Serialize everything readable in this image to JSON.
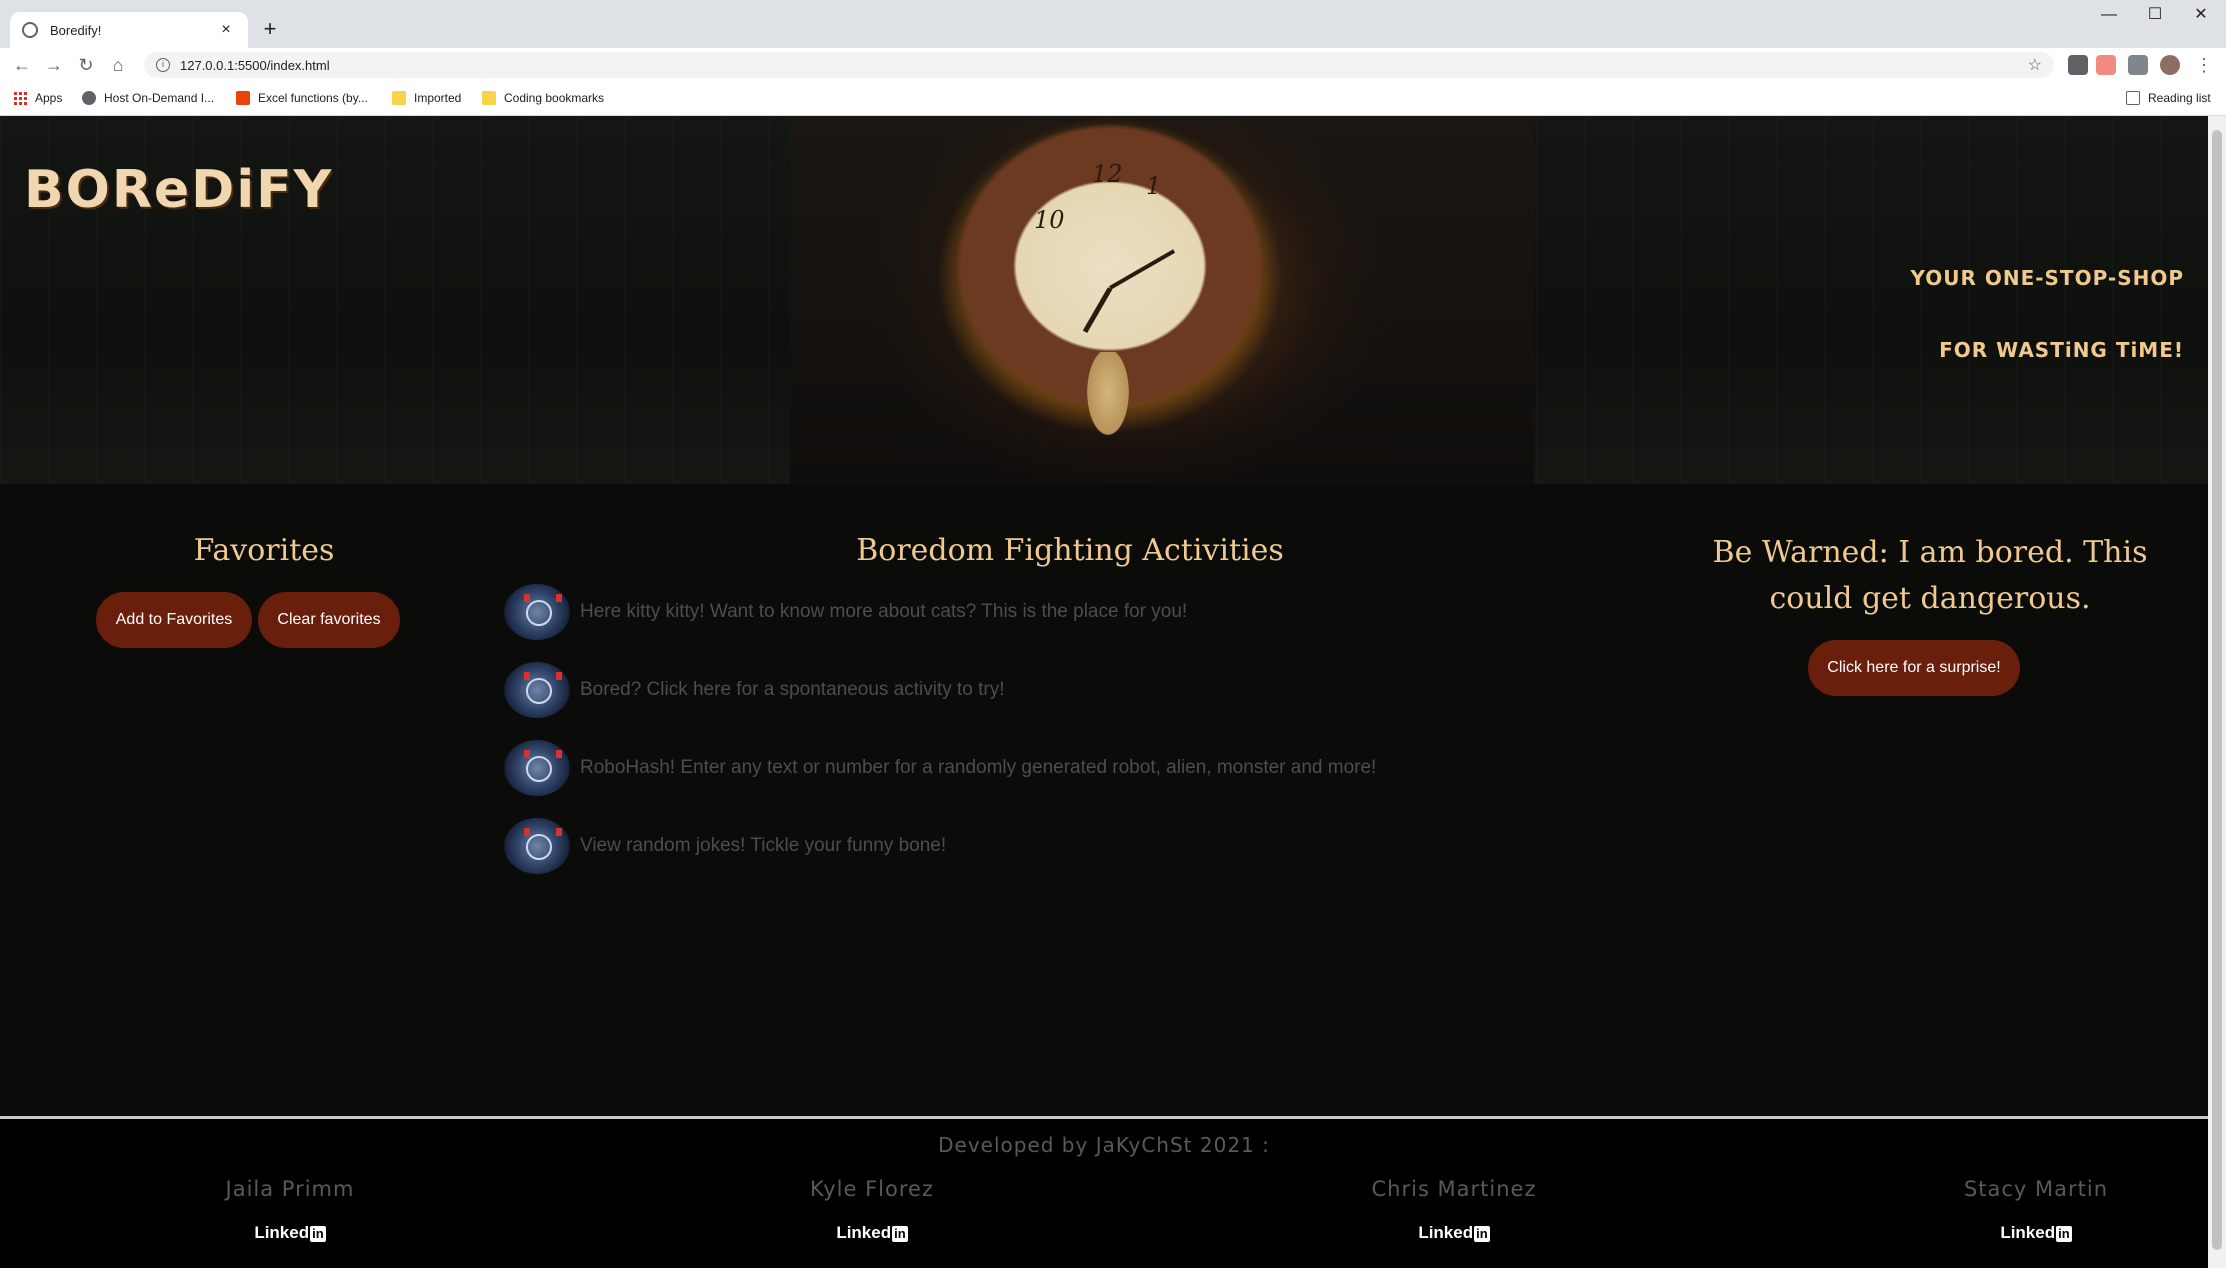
{
  "browser": {
    "tab_title": "Boredify!",
    "tab_close": "×",
    "new_tab": "+",
    "url": "127.0.0.1:5500/index.html",
    "bookmarks": [
      "Apps",
      "Host On-Demand I...",
      "Excel functions (by...",
      "Imported",
      "Coding bookmarks"
    ],
    "reading_list": "Reading list"
  },
  "header": {
    "brand": "BOReDiFY",
    "tagline_1": "YOUR ONE-STOP-SHOP",
    "tagline_2": "FOR WASTiNG TiME!"
  },
  "favorites": {
    "heading": "Favorites",
    "add_label": "Add to Favorites",
    "clear_label": "Clear favorites"
  },
  "activities": {
    "heading": "Boredom Fighting Activities",
    "items": [
      "Here kitty kitty! Want to know more about cats? This is the place for you!",
      "Bored? Click here for a spontaneous activity to try!",
      "RoboHash! Enter any text or number for a randomly generated robot, alien, monster and more!",
      "View random jokes! Tickle your funny bone!"
    ]
  },
  "surprise": {
    "heading": "Be Warned: I am bored. This could get dangerous.",
    "button_label": "Click here for a surprise!"
  },
  "footer": {
    "developed_by": "Developed by JaKyChSt 2021 :",
    "linkedin_text": "Linked",
    "linkedin_badge": "in",
    "members": [
      "Jaila Primm",
      "Kyle Florez",
      "Chris Martinez",
      "Stacy Martin"
    ]
  },
  "colors": {
    "accent_text": "#f0c98e",
    "button_bg": "#6a1e0c",
    "page_bg": "#0b0b0a"
  }
}
